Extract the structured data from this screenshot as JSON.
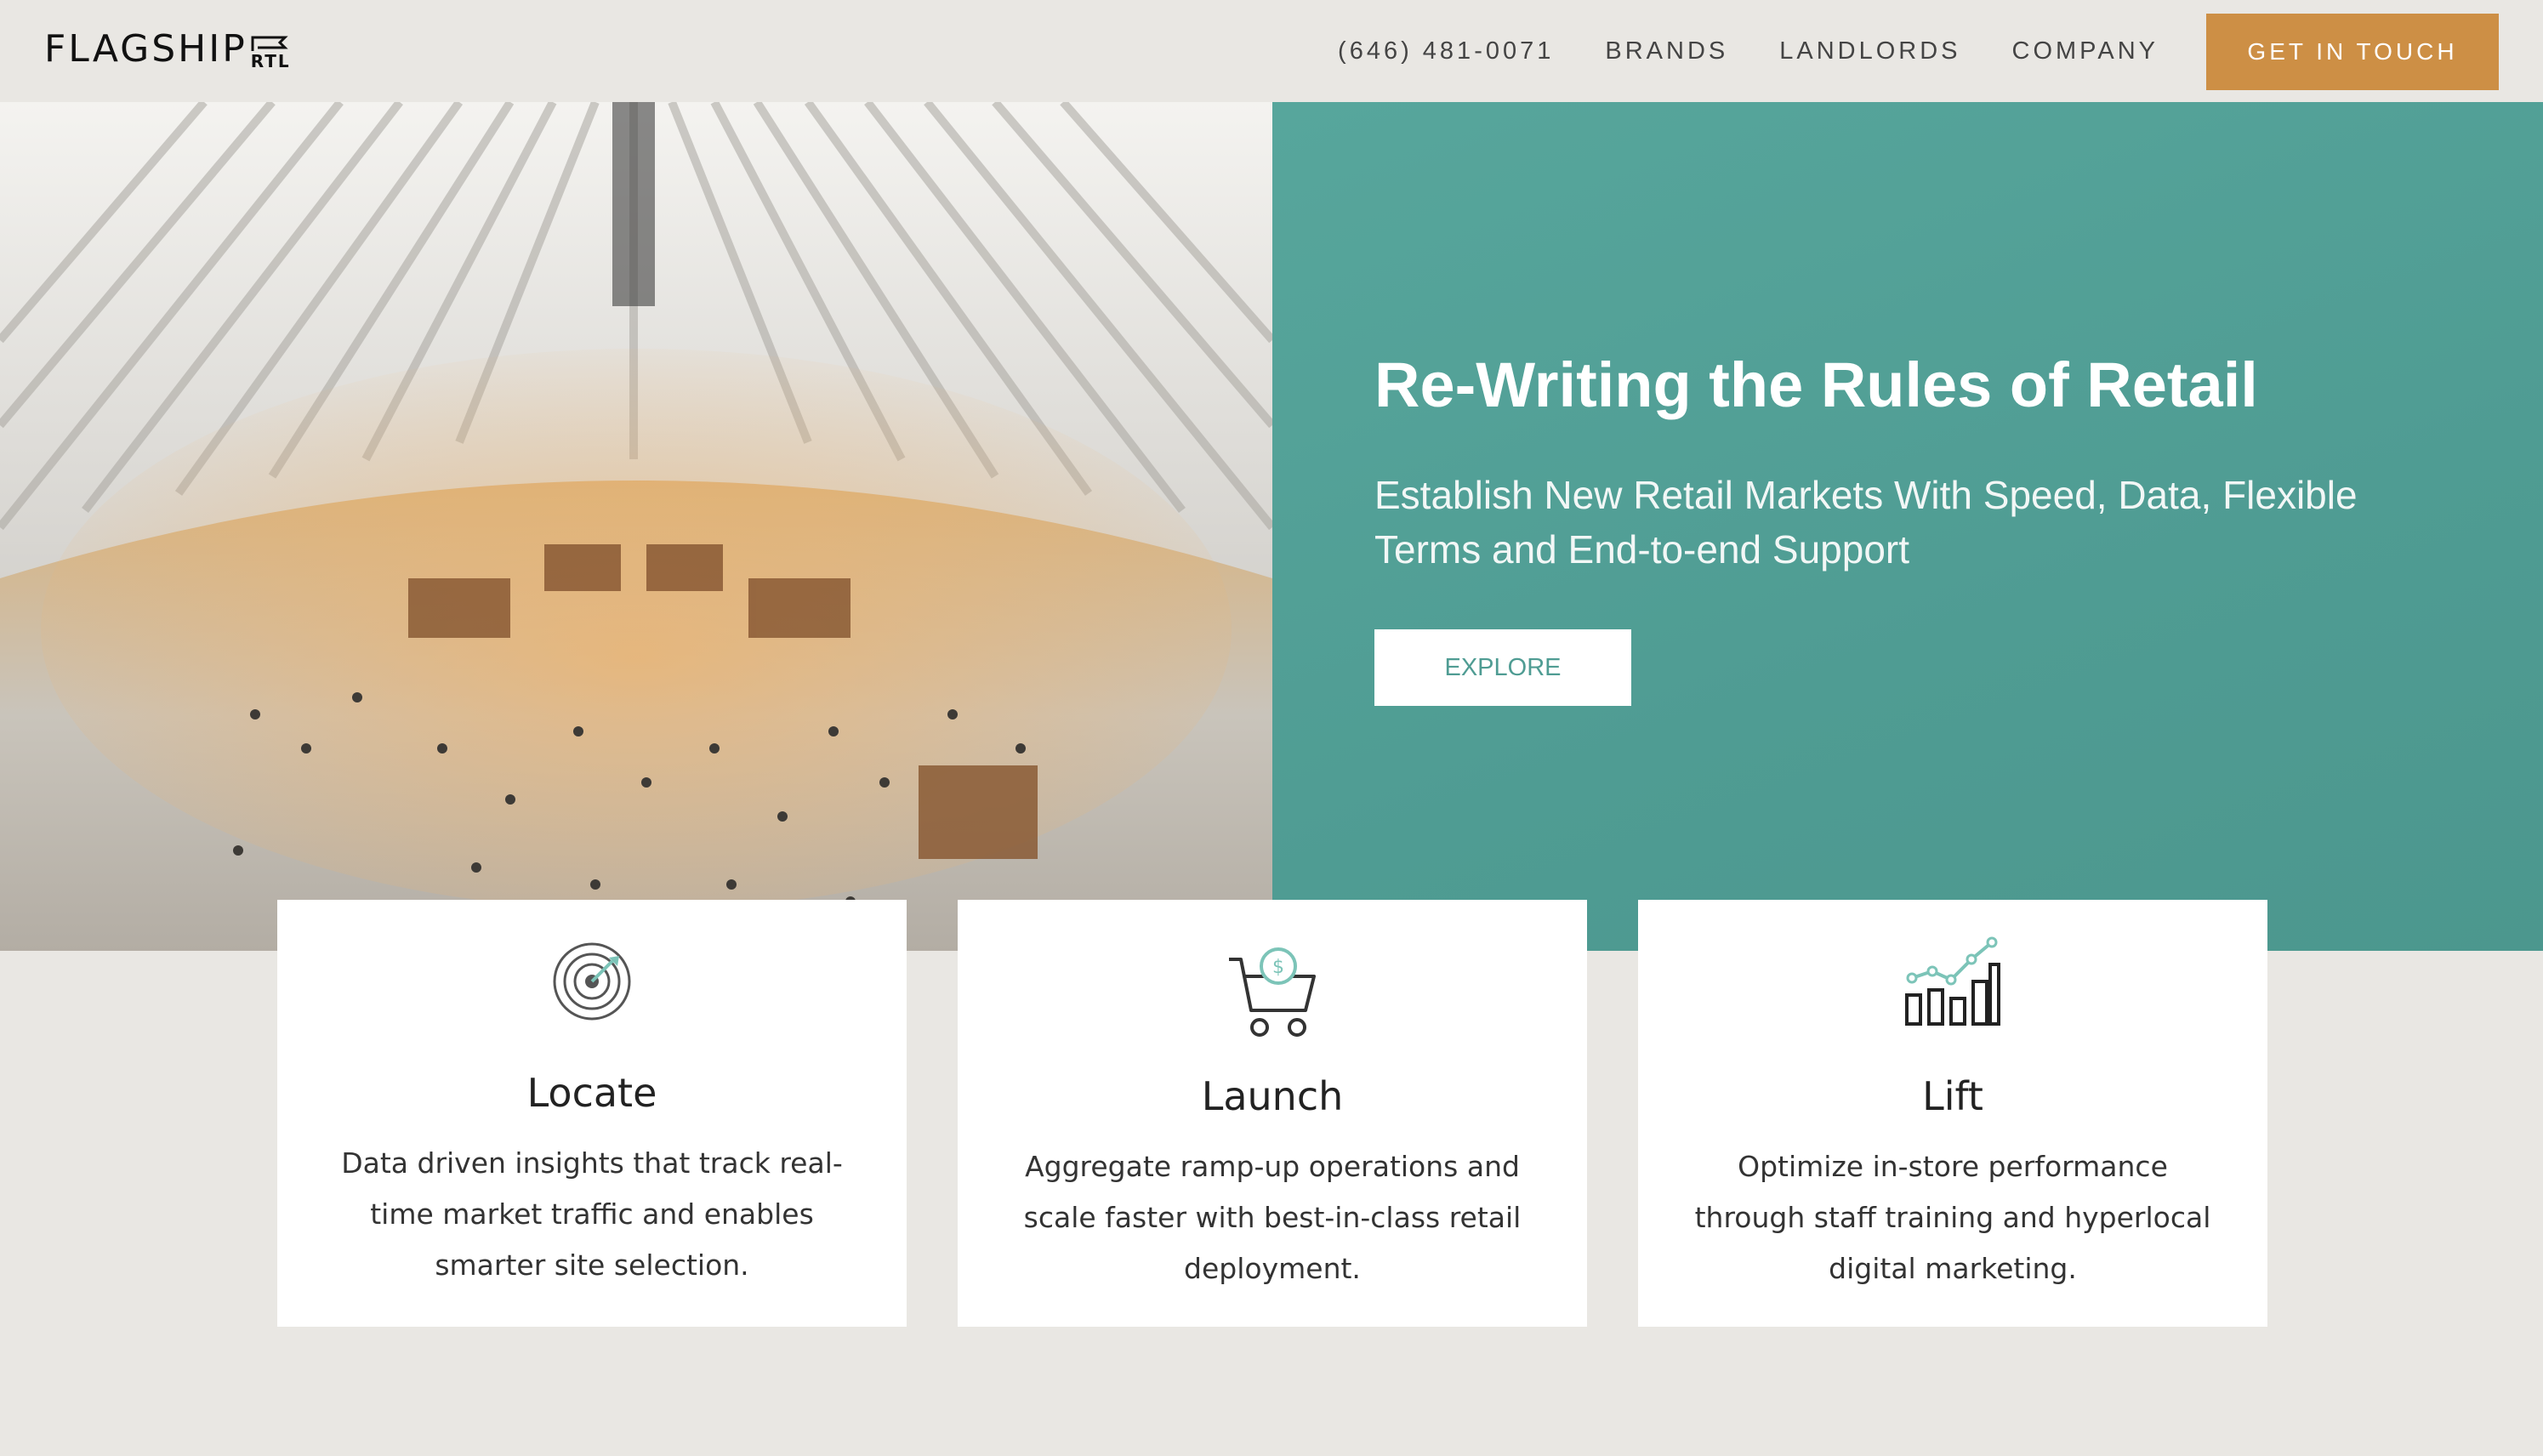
{
  "header": {
    "logo_text": "FLAGSHIP",
    "logo_sub": "RTL",
    "nav": [
      {
        "label": "(646) 481-0071"
      },
      {
        "label": "BRANDS"
      },
      {
        "label": "LANDLORDS"
      },
      {
        "label": "COMPANY"
      }
    ],
    "cta_label": "GET IN TOUCH"
  },
  "hero": {
    "image_icon": "mall-interior-photo",
    "title": "Re-Writing the Rules of Retail",
    "subtitle": "Establish New Retail Markets With Speed, Data, Flexible Terms and End-to-end Support",
    "button_label": "EXPLORE"
  },
  "cards": [
    {
      "icon": "target-icon",
      "title": "Locate",
      "text": "Data driven insights that track real-time market traffic and enables smarter site selection."
    },
    {
      "icon": "shopping-cart-icon",
      "title": "Launch",
      "text": "Aggregate ramp-up operations and scale faster with best-in-class retail deployment."
    },
    {
      "icon": "growth-chart-icon",
      "title": "Lift",
      "text": "Optimize in-store performance through staff training and hyperlocal digital marketing."
    }
  ],
  "colors": {
    "background": "#e9e7e3",
    "accent_orange": "#cd8f45",
    "teal": "#53a198",
    "icon_teal": "#7cc4b8"
  }
}
